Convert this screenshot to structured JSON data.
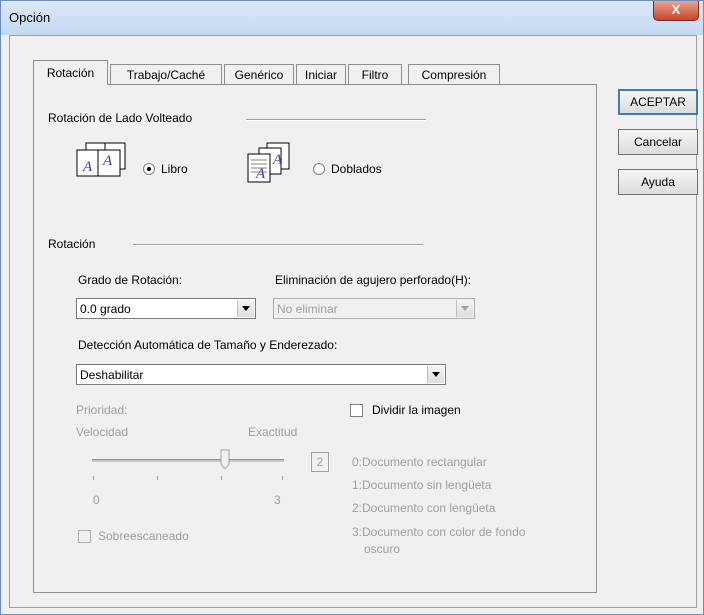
{
  "window": {
    "title": "Opción",
    "close_label": "X"
  },
  "tabs": [
    "Rotación",
    "Trabajo/Caché",
    "Genérico",
    "Iniciar",
    "Filtro",
    "Compresión"
  ],
  "buttons": {
    "accept": "ACEPTAR",
    "cancel": "Cancelar",
    "help": "Ayuda"
  },
  "flip_side": {
    "group_label": "Rotación de Lado Volteado",
    "book": "Libro",
    "fold": "Doblados",
    "selected": "Libro",
    "icon_letter": "A"
  },
  "rotation": {
    "group_label": "Rotación",
    "degree_label": "Grado de Rotación:",
    "degree_value": "0.0 grado",
    "hole_label": "Eliminación de agujero perforado(H):",
    "hole_value": "No eliminar",
    "auto_label": "Detección Automática de Tamaño y Enderezado:",
    "auto_value": "Deshabilitar"
  },
  "priority": {
    "label": "Prioridad:",
    "speed": "Velocidad",
    "accuracy": "Exactitud",
    "min": "0",
    "max": "3",
    "value": "2"
  },
  "split": {
    "label": "Dividir la imagen",
    "options": [
      "0:Documento rectangular",
      "1:Documento sin lengüeta",
      "2:Documento con lengüeta",
      "3:Documento con color de fondo",
      "oscuro"
    ]
  },
  "overscan": {
    "label": "Sobreescaneado"
  }
}
